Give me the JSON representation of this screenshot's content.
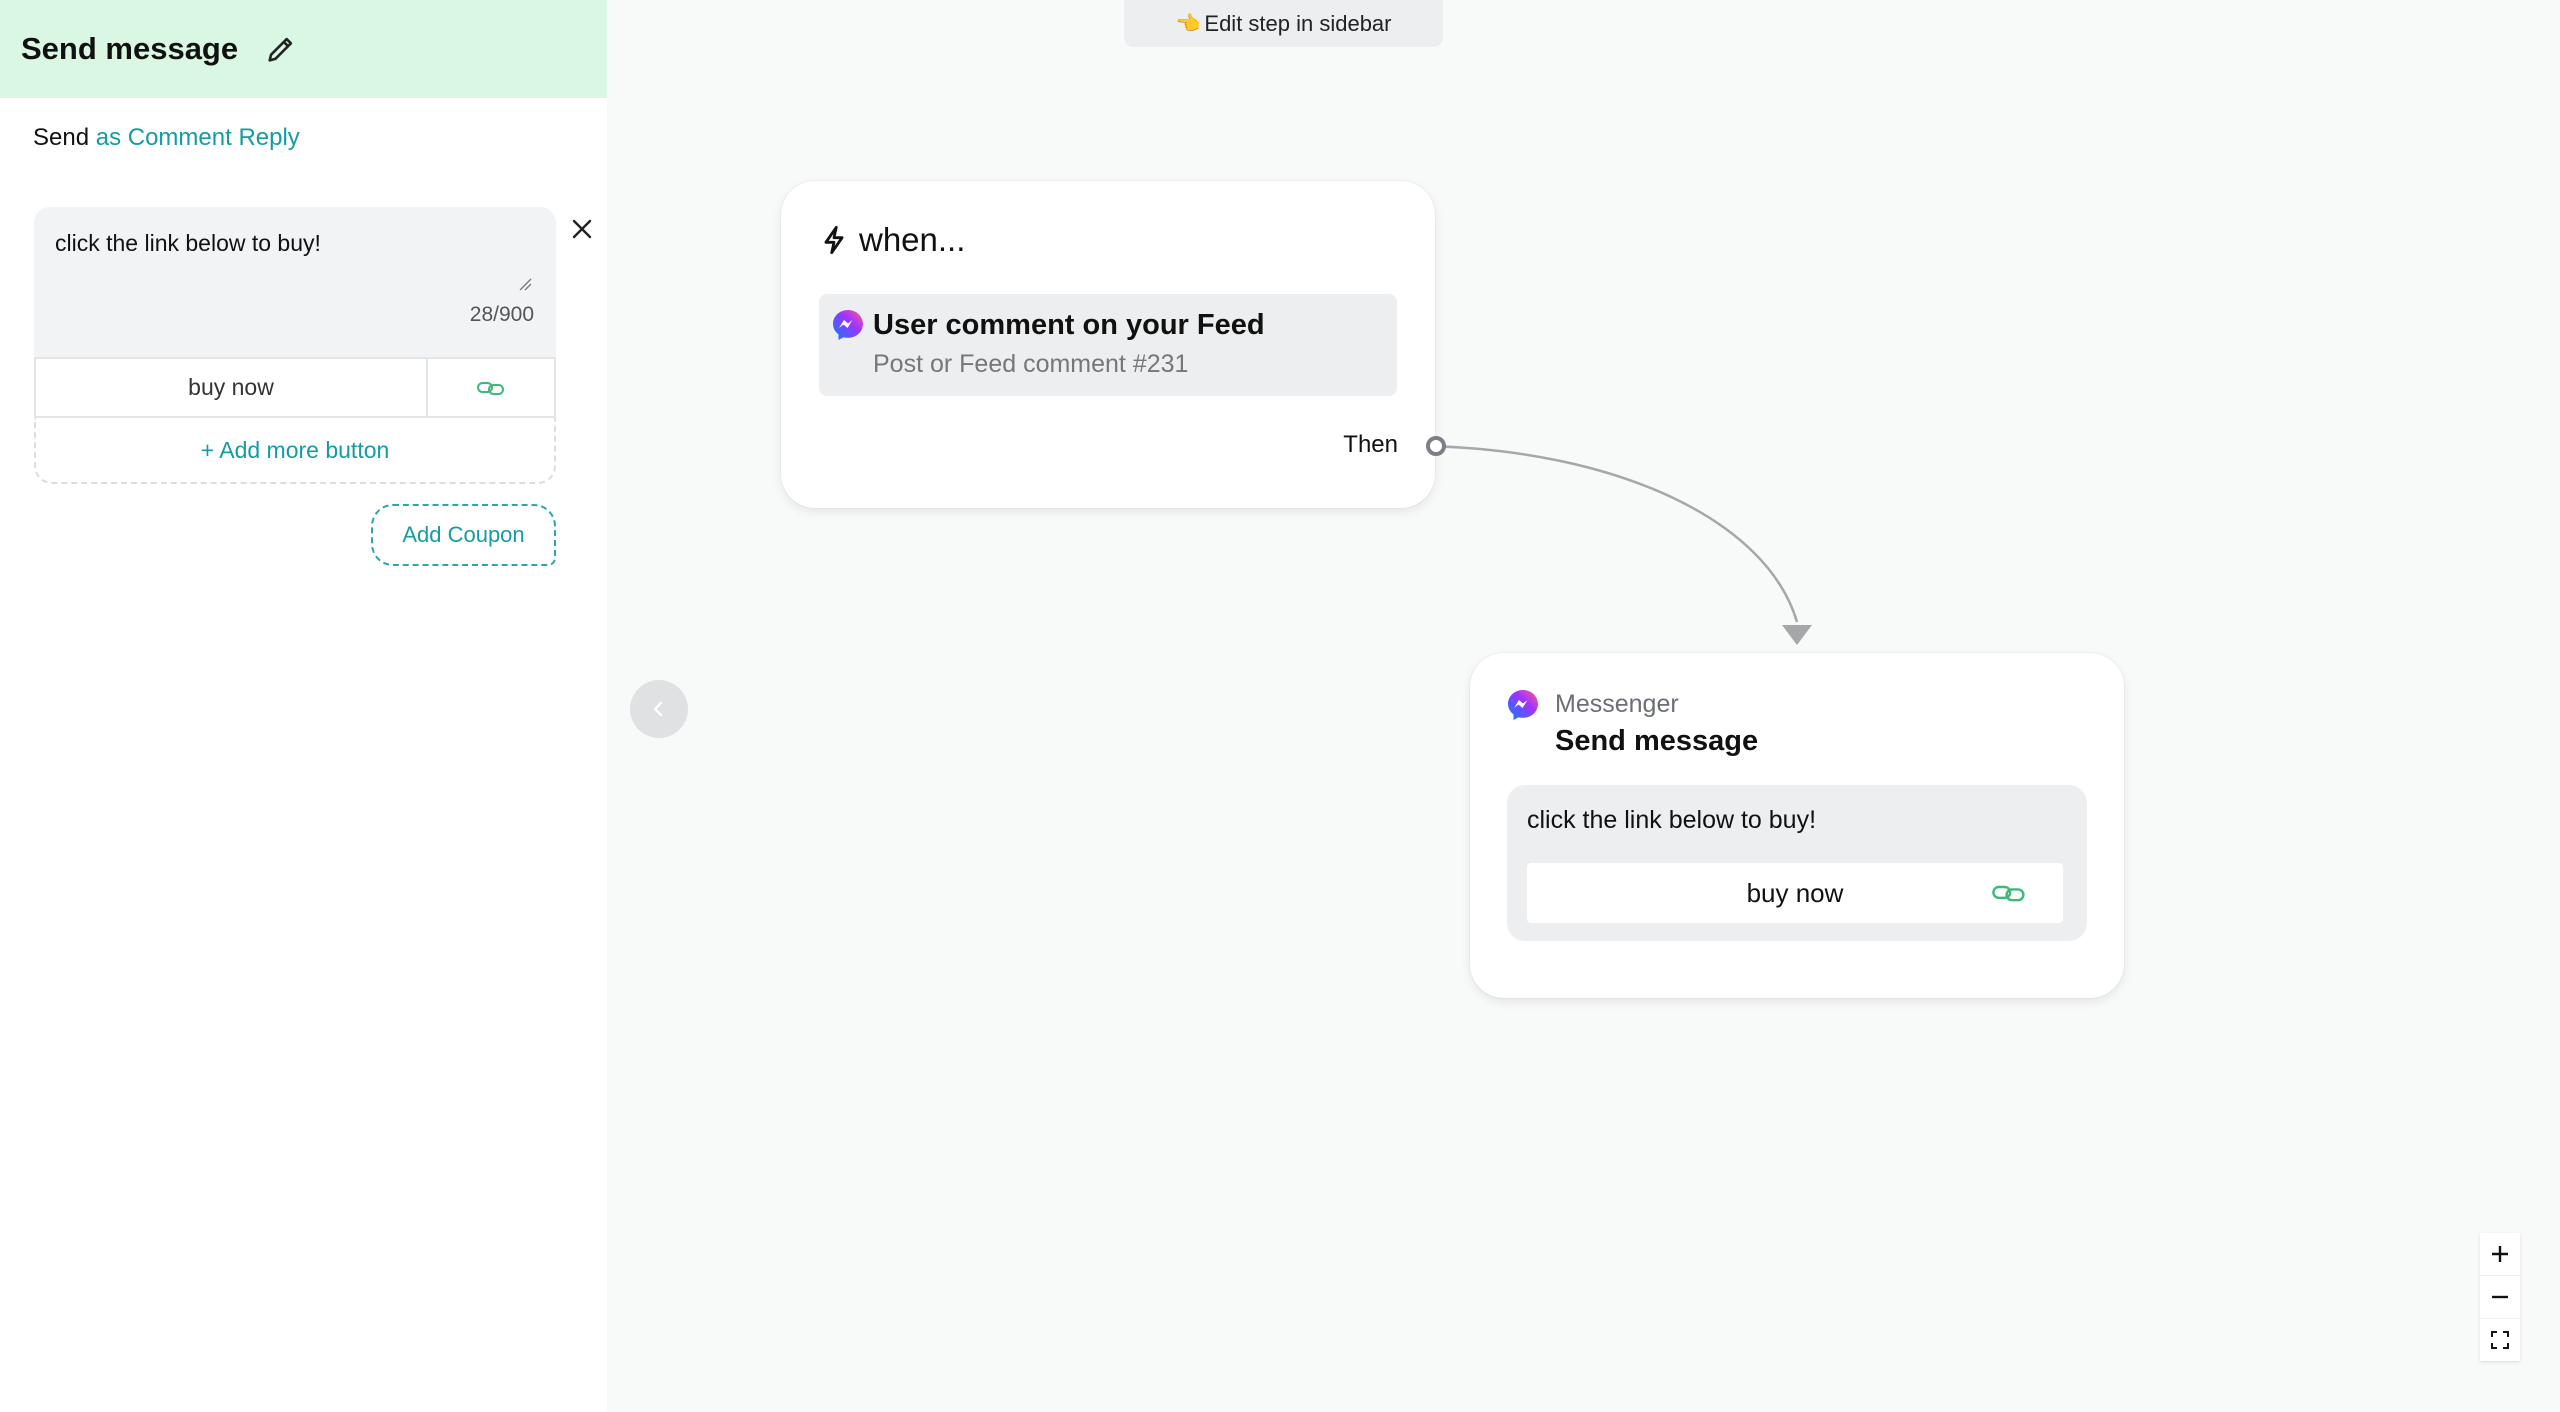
{
  "sidebar": {
    "title": "Send message",
    "send_prefix": "Send",
    "send_mode": "as Comment Reply",
    "message_text": "click the link below to buy!",
    "char_count": "28/900",
    "button_label": "buy now",
    "add_more_button": "+ Add more button",
    "add_coupon": "Add Coupon"
  },
  "canvas": {
    "hint": "Edit step in sidebar",
    "trigger": {
      "heading": "when...",
      "event_title": "User comment on your Feed",
      "event_subtitle": "Post or Feed comment #231",
      "then_label": "Then"
    },
    "action": {
      "channel": "Messenger",
      "title": "Send message",
      "message_text": "click the link below to buy!",
      "button_label": "buy now"
    }
  },
  "colors": {
    "header_bg": "#d9f7e3",
    "accent_teal": "#159ca3",
    "link_green": "#3fb97a",
    "canvas_bg": "#f8f9f9"
  },
  "icons": {
    "edit": "pencil-icon",
    "close": "close-icon",
    "link": "link-icon",
    "trigger": "lightning-bolt-icon",
    "channel": "messenger-icon",
    "collapse": "chevron-left-icon",
    "zoom_in": "plus-icon",
    "zoom_out": "minus-icon",
    "fit": "fit-view-icon"
  }
}
